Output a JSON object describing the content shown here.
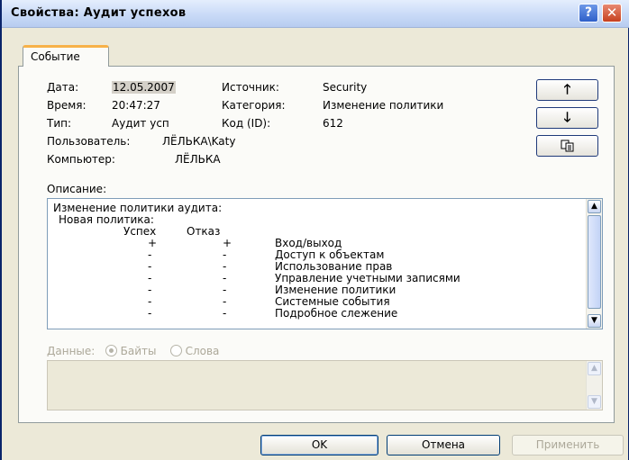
{
  "window": {
    "title": "Свойства: Аудит успехов"
  },
  "tab": {
    "label": "Событие"
  },
  "event": {
    "date_label": "Дата:",
    "date": "12.05.2007",
    "time_label": "Время:",
    "time": "20:47:27",
    "type_label": "Тип:",
    "type": "Аудит усп",
    "user_label": "Пользователь:",
    "user": "ЛЁЛЬКА\\Katy",
    "computer_label": "Компьютер:",
    "computer": "ЛЁЛЬКА",
    "source_label": "Источник:",
    "source": "Security",
    "category_label": "Категория:",
    "category": "Изменение политики",
    "id_label": "Код (ID):",
    "id": "612"
  },
  "description": {
    "label": "Описание:",
    "line1": "Изменение политики аудита:",
    "line2": "Новая политика:",
    "col_success": "Успех",
    "col_failure": "Отказ",
    "rows": [
      {
        "s": "+",
        "f": "+",
        "name": "Вход/выход"
      },
      {
        "s": "-",
        "f": "-",
        "name": "Доступ к объектам"
      },
      {
        "s": "-",
        "f": "-",
        "name": "Использование прав"
      },
      {
        "s": "-",
        "f": "-",
        "name": "Управление учетными записями"
      },
      {
        "s": "-",
        "f": "-",
        "name": "Изменение политики"
      },
      {
        "s": "-",
        "f": "-",
        "name": "Системные события"
      },
      {
        "s": "-",
        "f": "-",
        "name": "Подробное слежение"
      }
    ]
  },
  "data": {
    "label": "Данные:",
    "bytes": "Байты",
    "words": "Слова",
    "selected": "bytes"
  },
  "buttons": {
    "ok": "OK",
    "cancel": "Отмена",
    "apply": "Применить"
  },
  "icons": {
    "up": "arrow-up-icon",
    "down": "arrow-down-icon",
    "copy": "copy-icon",
    "help": "help-icon",
    "close": "close-icon"
  }
}
